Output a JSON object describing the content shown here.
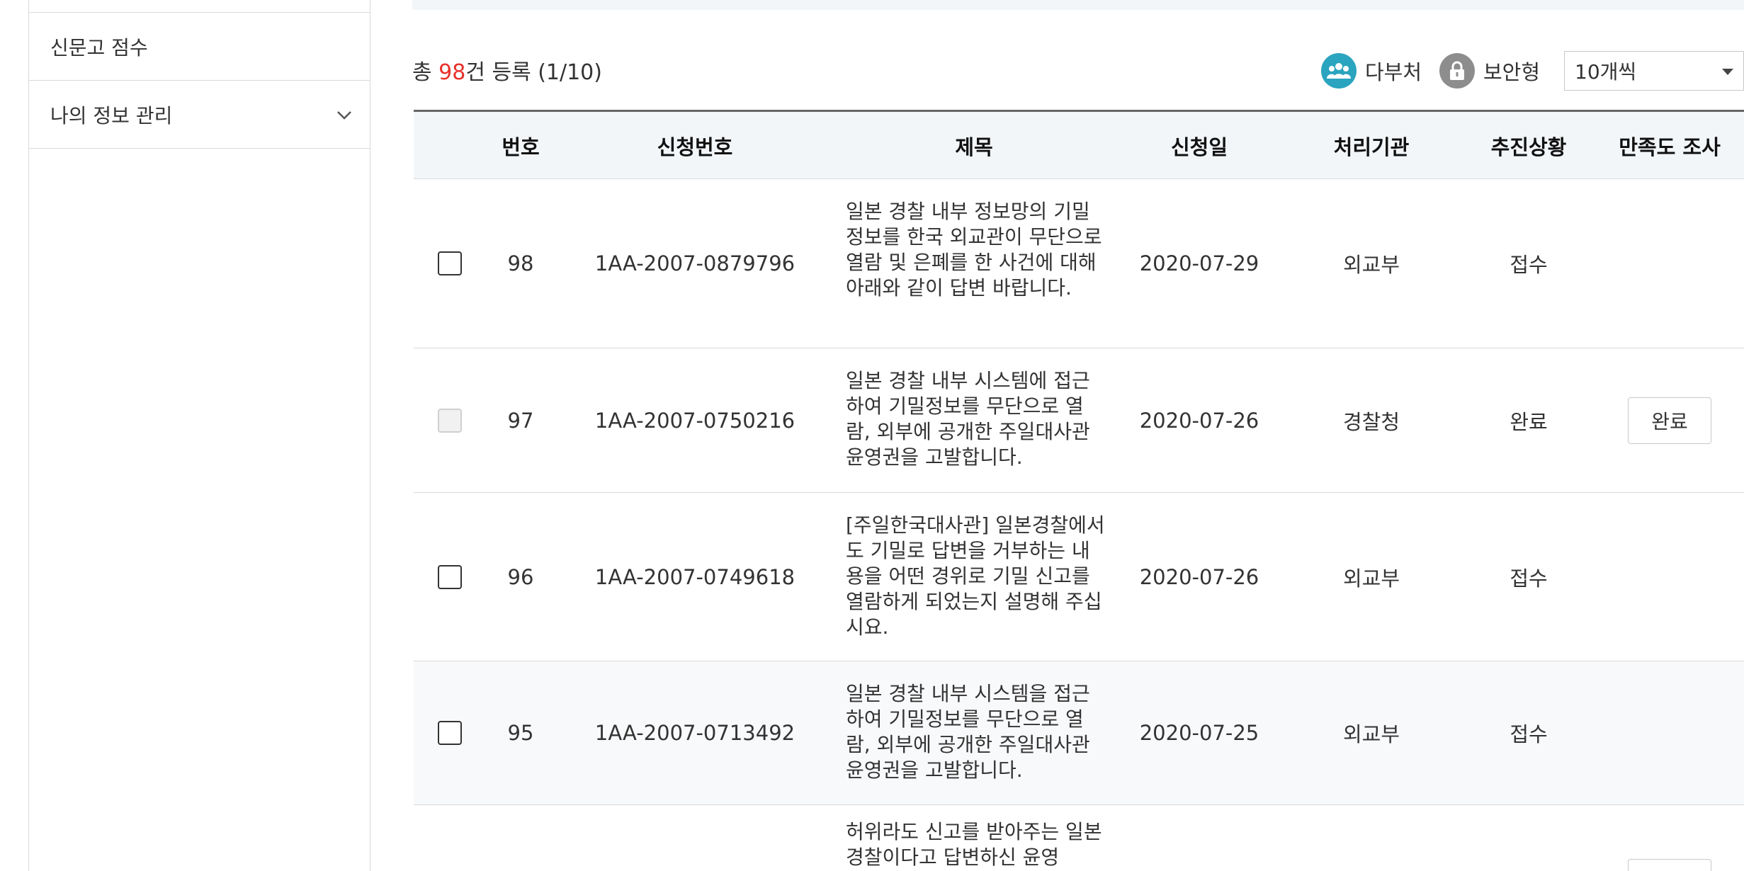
{
  "sidebar": {
    "items": [
      {
        "label": "신문고 점수"
      },
      {
        "label": "나의 정보 관리"
      }
    ]
  },
  "summary": {
    "prefix": "총 ",
    "count": "98",
    "suffix": "건 등록 (1/10)"
  },
  "legend": {
    "multi_label": "다부처",
    "secure_label": "보안형"
  },
  "page_size_select": {
    "selected": "10개씩"
  },
  "table": {
    "headers": [
      "번호",
      "신청번호",
      "제목",
      "신청일",
      "처리기관",
      "추진상황",
      "만족도 조사"
    ],
    "rows": [
      {
        "no": "98",
        "app_no": "1AA-2007-0879796",
        "title": "일본 경찰 내부 정보망의 기밀정보를 한국 외교관이 무단으로 열람 및 은폐를 한 사건에 대해 아래와 같이 답변 바랍니다.",
        "date": "2020-07-29",
        "agency": "외교부",
        "status": "접수",
        "survey": ""
      },
      {
        "no": "97",
        "app_no": "1AA-2007-0750216",
        "title": "일본 경찰 내부 시스템에 접근하여 기밀정보를 무단으로 열람, 외부에 공개한 주일대사관 윤영권을 고발합니다.",
        "date": "2020-07-26",
        "agency": "경찰청",
        "status": "완료",
        "survey": "완료"
      },
      {
        "no": "96",
        "app_no": "1AA-2007-0749618",
        "title": "[주일한국대사관] 일본경찰에서도 기밀로 답변을 거부하는 내용을 어떤 경위로 기밀 신고를 열람하게 되었는지 설명해 주십시요.",
        "date": "2020-07-26",
        "agency": "외교부",
        "status": "접수",
        "survey": ""
      },
      {
        "no": "95",
        "app_no": "1AA-2007-0713492",
        "title": "일본 경찰 내부 시스템을 접근하여 기밀정보를 무단으로 열람, 외부에 공개한 주일대사관 윤영권을 고발합니다.",
        "date": "2020-07-25",
        "agency": "외교부",
        "status": "접수",
        "survey": ""
      },
      {
        "title": "허위라도 신고를 받아주는 일본경찰이다고 답변하신 윤영"
      }
    ]
  },
  "colors": {
    "accent_red": "#e8302a",
    "multi_icon": "#2aa4bf",
    "secure_icon": "#8d8d8d",
    "header_bg": "#f3f6f9"
  },
  "icons": [
    "chevron-down-icon",
    "multi-agency-icon",
    "lock-icon",
    "dropdown-caret-icon"
  ]
}
